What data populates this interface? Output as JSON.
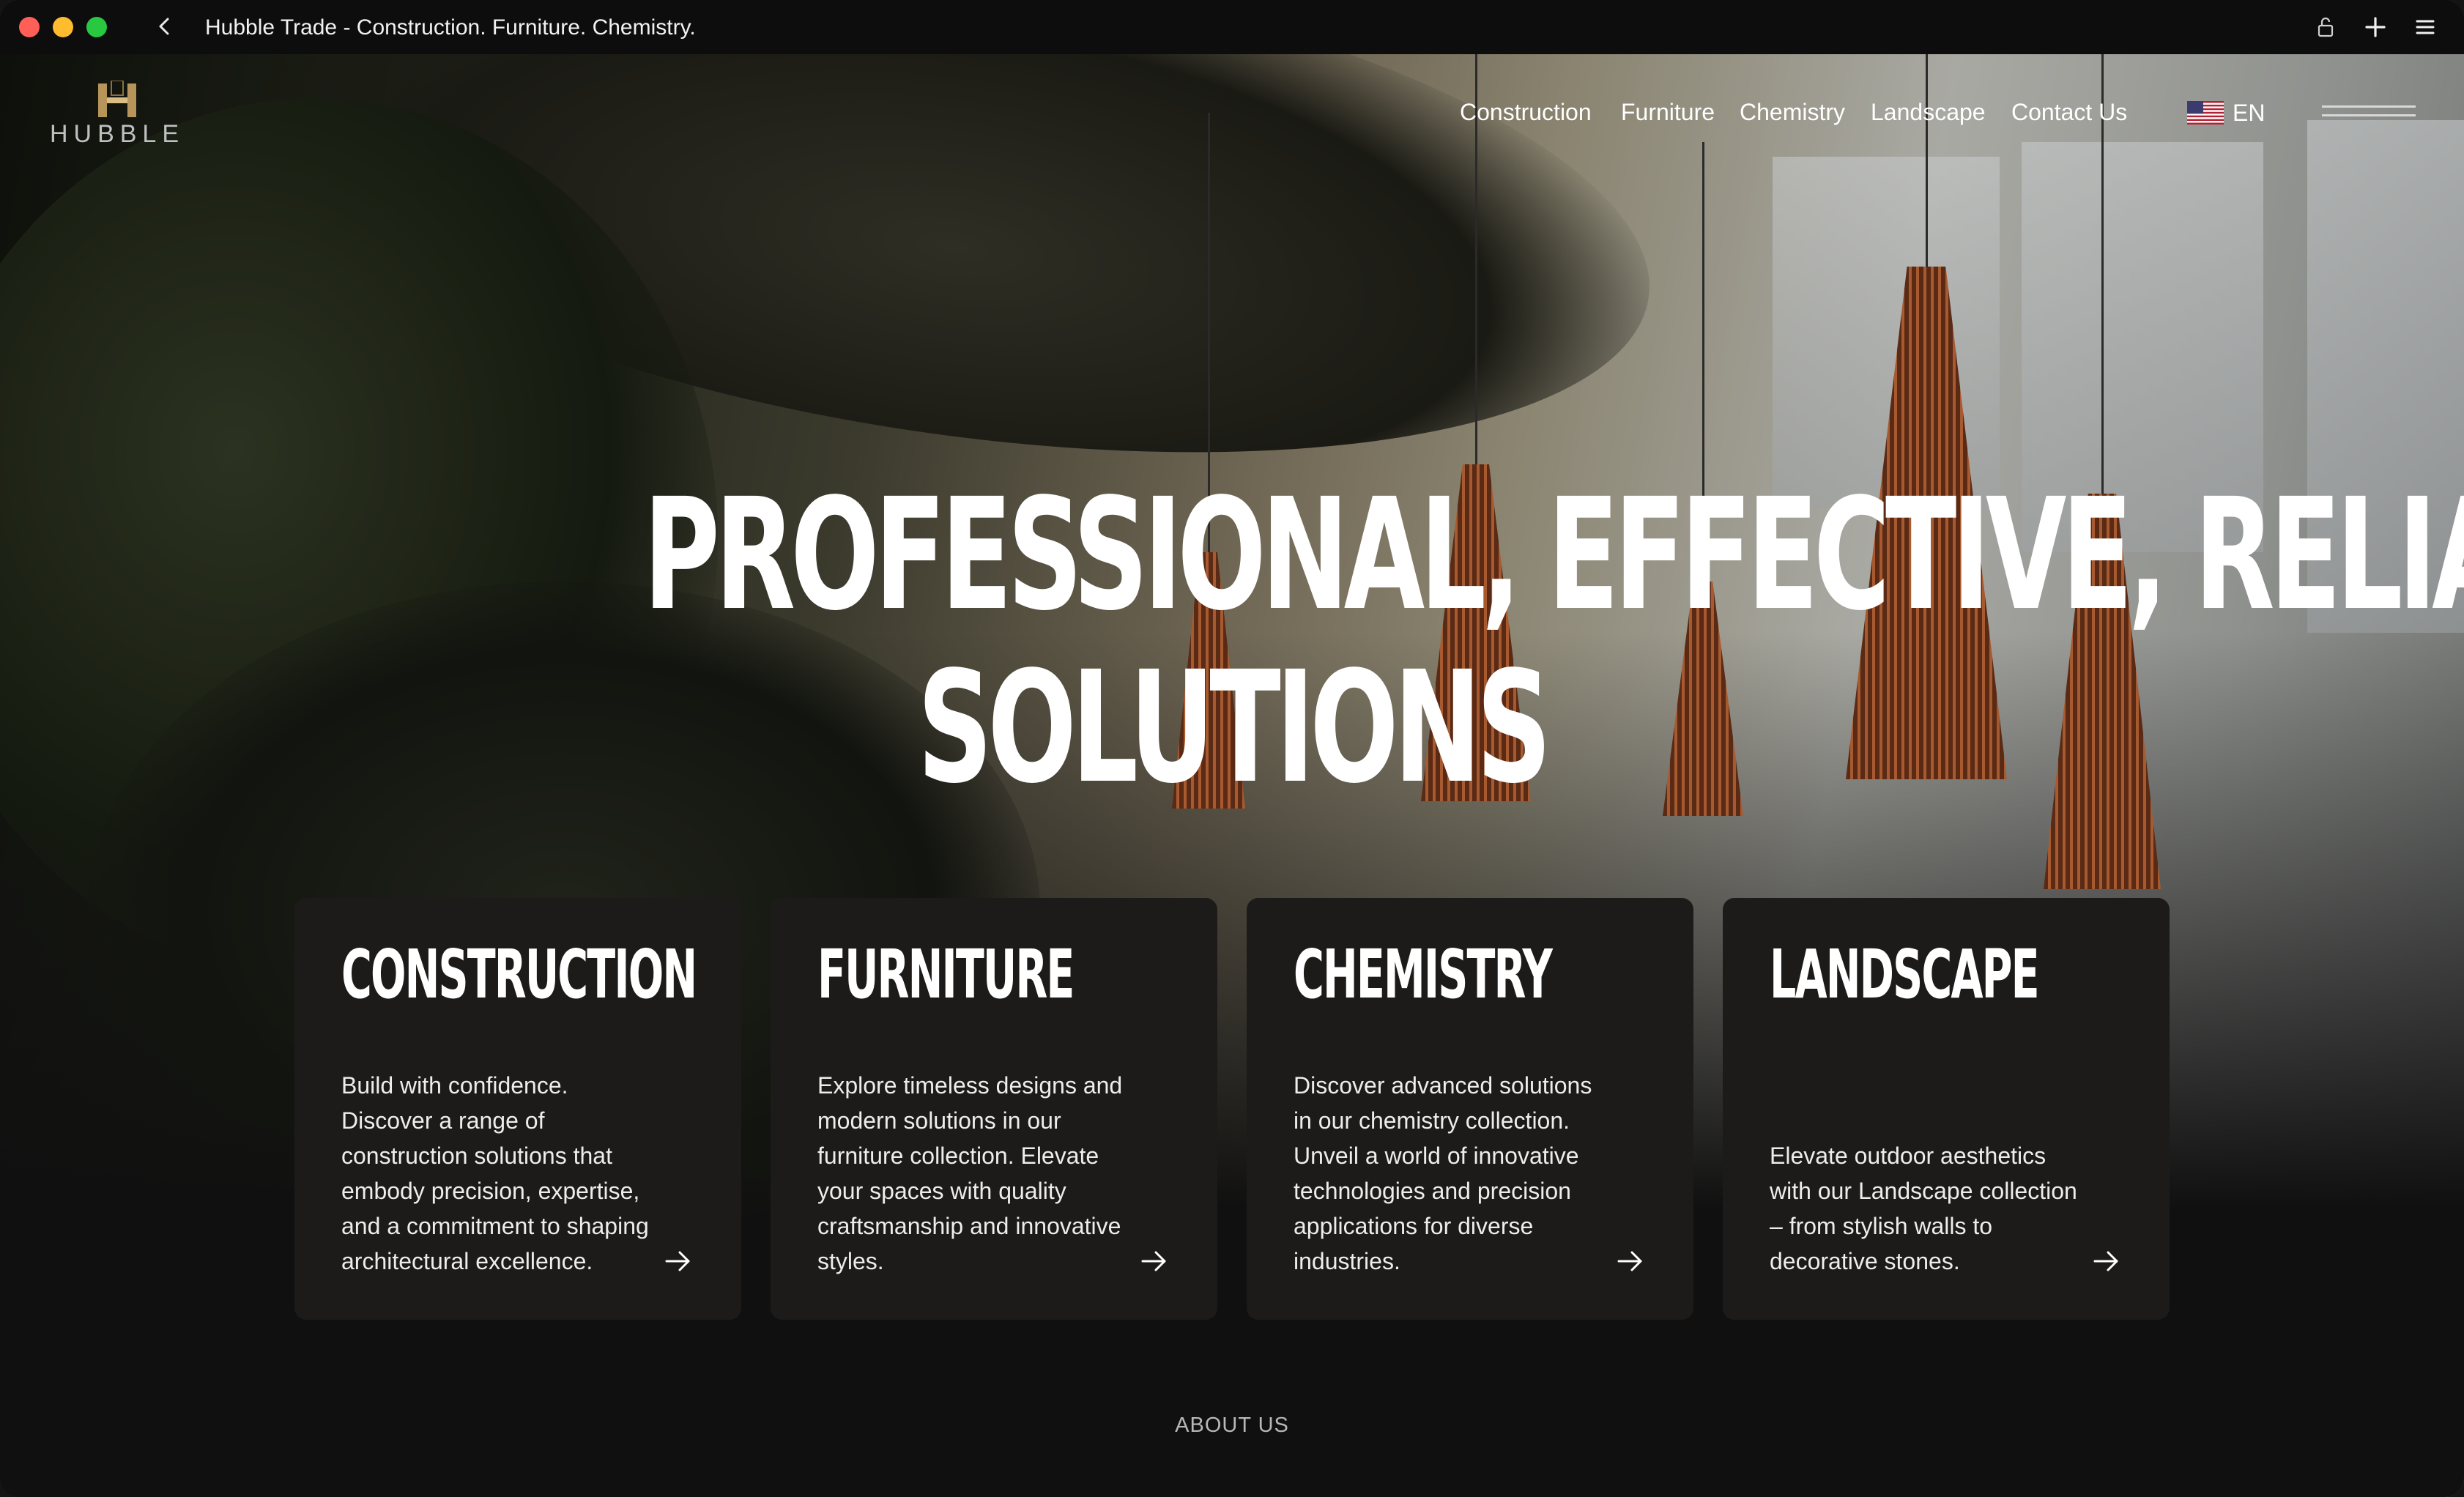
{
  "browser": {
    "title": "Hubble Trade - Construction. Furniture. Chemistry."
  },
  "brand": {
    "logo_text": "HUBBLE",
    "gold": "#b7955a"
  },
  "nav": {
    "links": [
      "Construction",
      "Furniture",
      "Chemistry",
      "Landscape",
      "Contact Us"
    ],
    "language": "EN",
    "language_flag_icon": "us-flag-icon"
  },
  "hero": {
    "headline_line1": "PROFESSIONAL, EFFECTIVE, RELIABLE",
    "headline_line2": "SOLUTIONS"
  },
  "cards": [
    {
      "title": "CONSTRUCTION",
      "text": "Build with confidence. Discover a range of construction solutions that embody precision, expertise, and a commitment to shaping architectural excellence."
    },
    {
      "title": "FURNITURE",
      "text": "Explore timeless designs and modern solutions in our furniture collection. Elevate your spaces with quality craftsmanship and innovative styles."
    },
    {
      "title": "CHEMISTRY",
      "text": "Discover advanced solutions in our chemistry collection. Unveil a world of innovative technologies and precision applications for diverse industries."
    },
    {
      "title": "LANDSCAPE",
      "text": "Elevate outdoor aesthetics with our Landscape collection – from stylish walls to decorative stones."
    }
  ],
  "footer": {
    "about_label": "ABOUT US"
  },
  "colors": {
    "card_bg": "#1c1b1a",
    "page_bg": "#101010",
    "text": "#ffffff"
  }
}
